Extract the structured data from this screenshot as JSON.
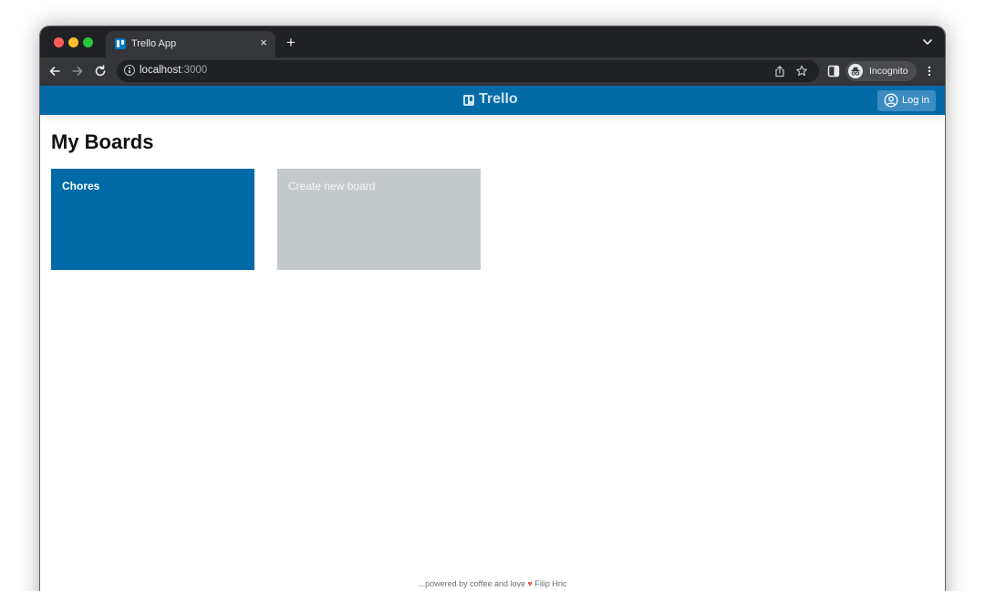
{
  "browser": {
    "tab": {
      "title": "Trello App",
      "close_glyph": "×"
    },
    "new_tab_glyph": "+",
    "address": {
      "host": "localhost",
      "port": ":3000"
    },
    "profile": {
      "label": "Incognito"
    }
  },
  "app": {
    "brand": "Trello",
    "login_label": "Log in",
    "page_title": "My Boards",
    "boards": [
      {
        "name": "Chores",
        "color": "#026aa7"
      }
    ],
    "create_board_label": "Create new board",
    "footer": {
      "text": "...powered by coffee and love",
      "heart": "♥",
      "author": "Filip Hric"
    }
  },
  "colors": {
    "brand_blue": "#026aa7",
    "create_board_gray": "#c4c9cc",
    "chrome_dark": "#202124"
  }
}
